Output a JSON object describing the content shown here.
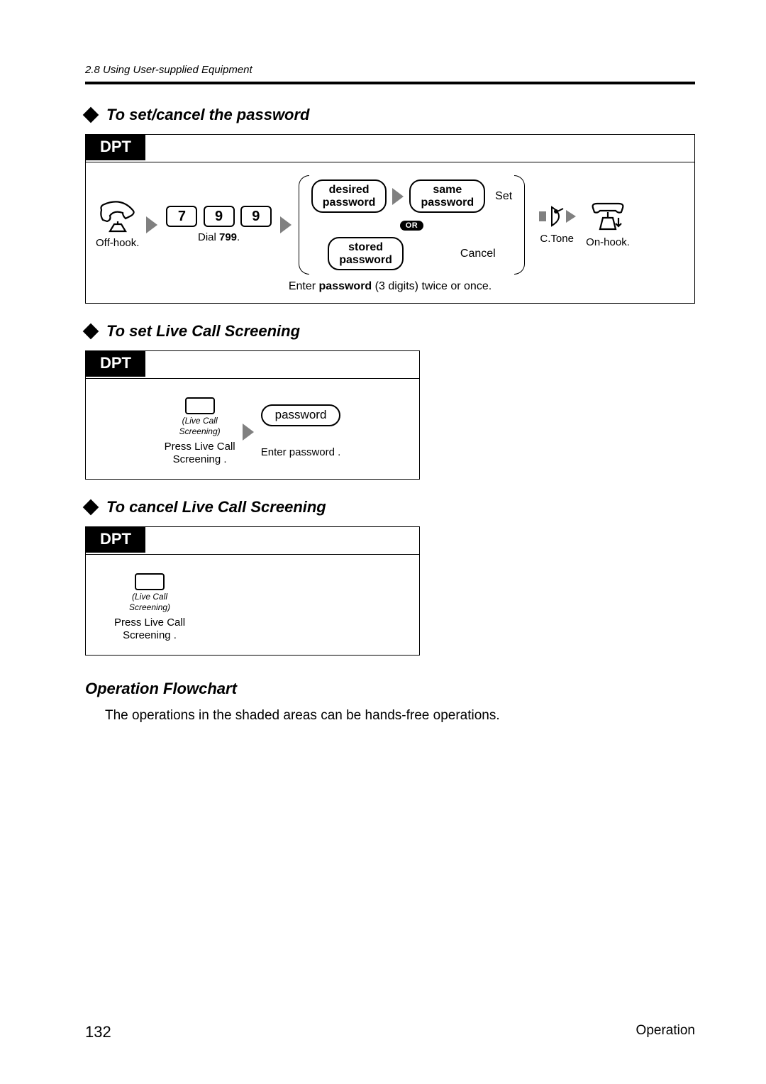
{
  "header": {
    "section": "2.8   Using User-supplied Equipment"
  },
  "sec1": {
    "title": "To set/cancel the password",
    "tab": "DPT",
    "offhook": "Off-hook.",
    "dial_pre": "Dial ",
    "dial_num": "799",
    "dial_post": ".",
    "k1": "7",
    "k2": "9",
    "k3": "9",
    "p_desired_l1": "desired",
    "p_desired_l2": "password",
    "p_same_l1": "same",
    "p_same_l2": "password",
    "p_stored_l1": "stored",
    "p_stored_l2": "password",
    "set": "Set",
    "cancel": "Cancel",
    "or": "OR",
    "ctone": "C.Tone",
    "onhook": "On-hook.",
    "note_pre": "Enter ",
    "note_b": "password",
    "note_post": " (3 digits) twice or once."
  },
  "sec2": {
    "title": "To set Live Call Screening",
    "tab": "DPT",
    "btn_l1": "(Live Call",
    "btn_l2": "Screening)",
    "cap_l1": "Press Live Call",
    "cap_l2": "Screening .",
    "pill": "password",
    "cap2": "Enter password ."
  },
  "sec3": {
    "title": "To cancel Live Call Screening",
    "tab": "DPT",
    "btn_l1": "(Live Call",
    "btn_l2": "Screening)",
    "cap_l1": "Press Live Call",
    "cap_l2": "Screening ."
  },
  "sec4": {
    "title": "Operation Flowchart",
    "text": "The operations in the shaded areas can be hands-free operations."
  },
  "footer": {
    "page": "132",
    "label": "Operation"
  }
}
